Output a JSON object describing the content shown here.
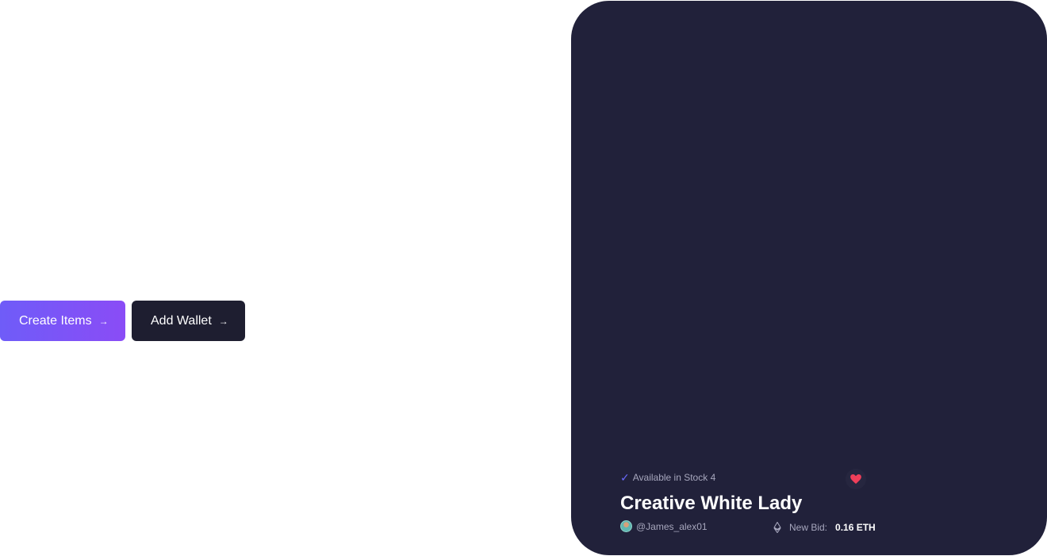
{
  "actions": {
    "create_label": "Create Items",
    "wallet_label": "Add Wallet",
    "arrow_icon": "→"
  },
  "card": {
    "stock_text": "Available in Stock 4",
    "title": "Creative White Lady",
    "owner_handle": "@James_alex01",
    "bid_label": "New Bid:",
    "bid_value": "0.16 ETH",
    "check_icon": "✓",
    "like_icon": "heart-icon",
    "eth_icon": "ethereum-icon",
    "colors": {
      "card_bg": "#21213a",
      "accent": "#6f5cf8",
      "heart": "#ef3f5a"
    }
  }
}
